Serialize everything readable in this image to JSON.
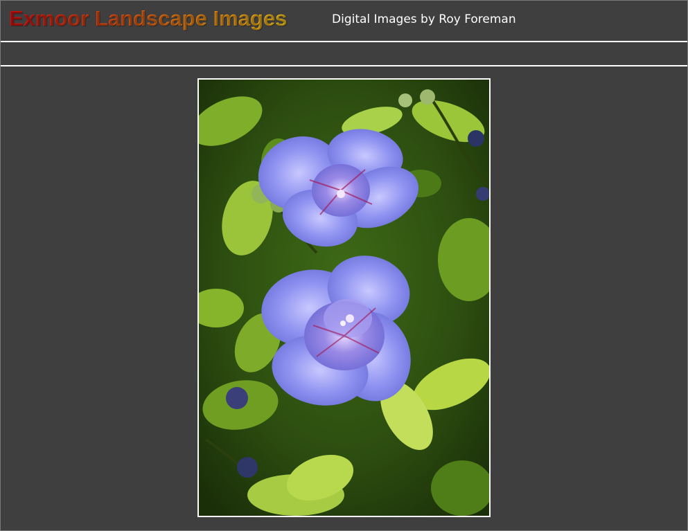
{
  "header": {
    "site_title": "Exmoor Landscape Images",
    "subtitle": "Digital Images by Roy Foreman"
  },
  "colors": {
    "background": "#3f3f3f",
    "title_gradient_start": "#d40e0e",
    "title_gradient_end": "#f2c21a",
    "subtitle": "#ffffff",
    "rule_lines": "#ffffff"
  },
  "main": {
    "photo": {
      "subject": "blue hibiscus flowers among green leaves"
    }
  }
}
